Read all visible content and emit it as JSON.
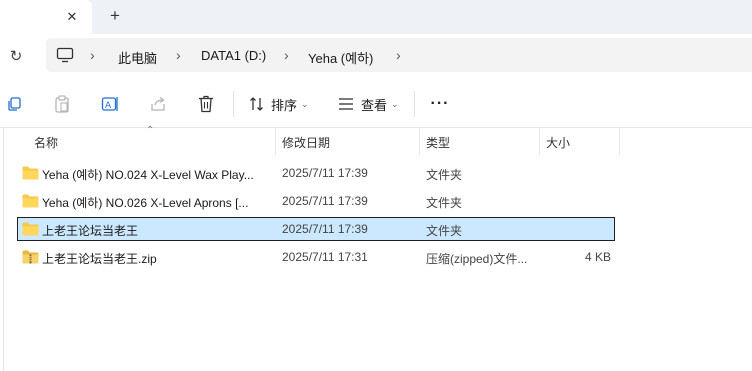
{
  "tabs": {
    "close_glyph": "✕",
    "new_tab_glyph": "+"
  },
  "address": {
    "refresh_glyph": "↻",
    "breadcrumb": [
      "此电脑",
      "DATA1 (D:)",
      "Yeha (예하)"
    ],
    "separator": "›"
  },
  "toolbar": {
    "sort_label": "排序",
    "view_label": "查看",
    "more_glyph": "···",
    "chevron": "⌄",
    "accent_color": "#1f6fd1"
  },
  "columns": {
    "name": "名称",
    "date": "修改日期",
    "type": "类型",
    "size": "大小",
    "sort_glyph": "⌃"
  },
  "files": [
    {
      "name": "Yeha (예하) NO.024 X-Level Wax Play...",
      "date": "2025/7/11 17:39",
      "type": "文件夹",
      "size": "",
      "icon": "folder-icon",
      "selected": false
    },
    {
      "name": "Yeha (예하) NO.026 X-Level Aprons [...",
      "date": "2025/7/11 17:39",
      "type": "文件夹",
      "size": "",
      "icon": "folder-icon",
      "selected": false
    },
    {
      "name": "上老王论坛当老王",
      "date": "2025/7/11 17:39",
      "type": "文件夹",
      "size": "",
      "icon": "folder-icon",
      "selected": true
    },
    {
      "name": "上老王论坛当老王.zip",
      "date": "2025/7/11 17:31",
      "type": "压缩(zipped)文件...",
      "size": "4 KB",
      "icon": "zip-icon",
      "selected": false
    }
  ],
  "colors": {
    "selection_bg": "#cce8ff",
    "folder": "#f7c948",
    "tabbar_bg": "#eef1f5"
  }
}
